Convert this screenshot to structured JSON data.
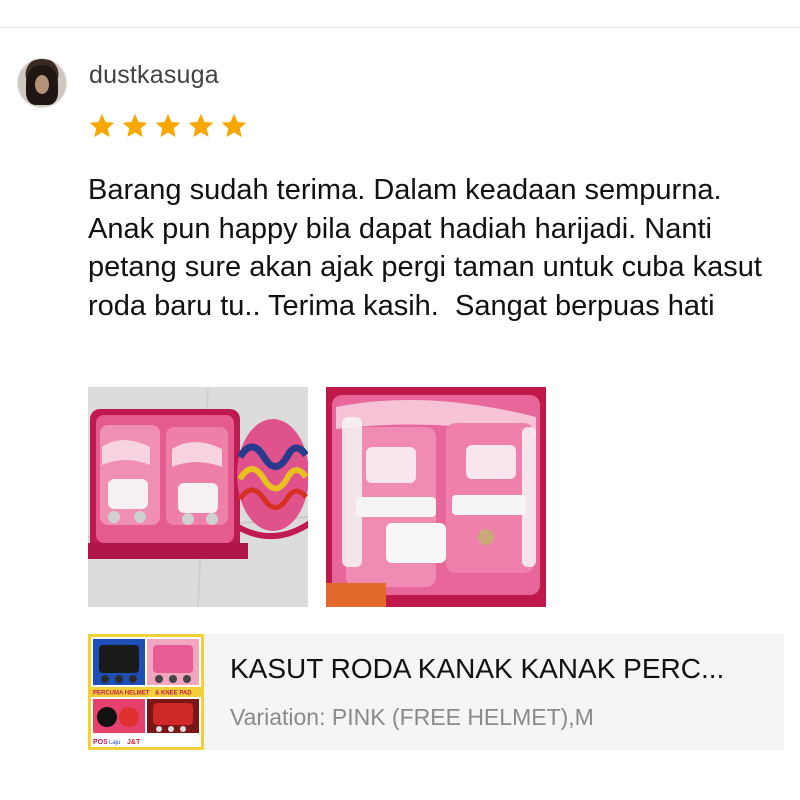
{
  "review": {
    "username": "dustkasuga",
    "rating": 5,
    "rating_max": 5,
    "star_color": "#f6a700",
    "text": "Barang sudah terima. Dalam keadaan sempurna. Anak pun happy bila dapat hadiah harijadi. Nanti petang sure akan ajak pergi taman untuk cuba kasut roda baru tu.. Terima kasih.  Sangat berpuas hati",
    "photos": [
      {
        "icon": "pink-roller-skates-with-helmet-photo"
      },
      {
        "icon": "pink-roller-skate-closeup-photo"
      }
    ]
  },
  "product": {
    "name": "KASUT RODA KANAK KANAK PERC...",
    "variation_label": "Variation:",
    "variation_value": "PINK (FREE HELMET),M",
    "thumb_icon": "product-thumbnail",
    "thumb_text": {
      "banner_left": "PERCUMA HELMET",
      "banner_right": "& KNEE PAD",
      "brand_left": "POS",
      "brand_mid": "Laju",
      "brand_right": "J&T"
    }
  }
}
